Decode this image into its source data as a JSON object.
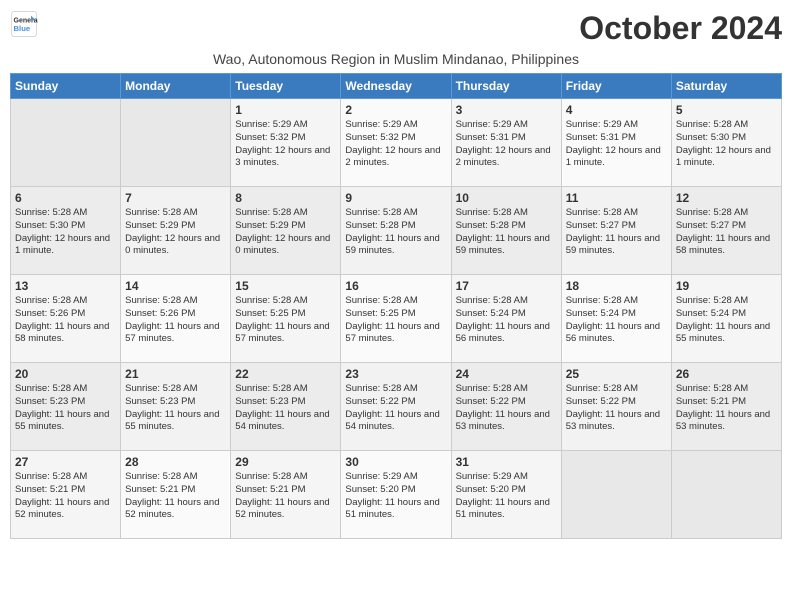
{
  "header": {
    "logo_line1": "General",
    "logo_line2": "Blue",
    "month_title": "October 2024",
    "subtitle": "Wao, Autonomous Region in Muslim Mindanao, Philippines"
  },
  "weekdays": [
    "Sunday",
    "Monday",
    "Tuesday",
    "Wednesday",
    "Thursday",
    "Friday",
    "Saturday"
  ],
  "weeks": [
    [
      {
        "day": "",
        "info": ""
      },
      {
        "day": "",
        "info": ""
      },
      {
        "day": "1",
        "info": "Sunrise: 5:29 AM\nSunset: 5:32 PM\nDaylight: 12 hours and 3 minutes."
      },
      {
        "day": "2",
        "info": "Sunrise: 5:29 AM\nSunset: 5:32 PM\nDaylight: 12 hours and 2 minutes."
      },
      {
        "day": "3",
        "info": "Sunrise: 5:29 AM\nSunset: 5:31 PM\nDaylight: 12 hours and 2 minutes."
      },
      {
        "day": "4",
        "info": "Sunrise: 5:29 AM\nSunset: 5:31 PM\nDaylight: 12 hours and 1 minute."
      },
      {
        "day": "5",
        "info": "Sunrise: 5:28 AM\nSunset: 5:30 PM\nDaylight: 12 hours and 1 minute."
      }
    ],
    [
      {
        "day": "6",
        "info": "Sunrise: 5:28 AM\nSunset: 5:30 PM\nDaylight: 12 hours and 1 minute."
      },
      {
        "day": "7",
        "info": "Sunrise: 5:28 AM\nSunset: 5:29 PM\nDaylight: 12 hours and 0 minutes."
      },
      {
        "day": "8",
        "info": "Sunrise: 5:28 AM\nSunset: 5:29 PM\nDaylight: 12 hours and 0 minutes."
      },
      {
        "day": "9",
        "info": "Sunrise: 5:28 AM\nSunset: 5:28 PM\nDaylight: 11 hours and 59 minutes."
      },
      {
        "day": "10",
        "info": "Sunrise: 5:28 AM\nSunset: 5:28 PM\nDaylight: 11 hours and 59 minutes."
      },
      {
        "day": "11",
        "info": "Sunrise: 5:28 AM\nSunset: 5:27 PM\nDaylight: 11 hours and 59 minutes."
      },
      {
        "day": "12",
        "info": "Sunrise: 5:28 AM\nSunset: 5:27 PM\nDaylight: 11 hours and 58 minutes."
      }
    ],
    [
      {
        "day": "13",
        "info": "Sunrise: 5:28 AM\nSunset: 5:26 PM\nDaylight: 11 hours and 58 minutes."
      },
      {
        "day": "14",
        "info": "Sunrise: 5:28 AM\nSunset: 5:26 PM\nDaylight: 11 hours and 57 minutes."
      },
      {
        "day": "15",
        "info": "Sunrise: 5:28 AM\nSunset: 5:25 PM\nDaylight: 11 hours and 57 minutes."
      },
      {
        "day": "16",
        "info": "Sunrise: 5:28 AM\nSunset: 5:25 PM\nDaylight: 11 hours and 57 minutes."
      },
      {
        "day": "17",
        "info": "Sunrise: 5:28 AM\nSunset: 5:24 PM\nDaylight: 11 hours and 56 minutes."
      },
      {
        "day": "18",
        "info": "Sunrise: 5:28 AM\nSunset: 5:24 PM\nDaylight: 11 hours and 56 minutes."
      },
      {
        "day": "19",
        "info": "Sunrise: 5:28 AM\nSunset: 5:24 PM\nDaylight: 11 hours and 55 minutes."
      }
    ],
    [
      {
        "day": "20",
        "info": "Sunrise: 5:28 AM\nSunset: 5:23 PM\nDaylight: 11 hours and 55 minutes."
      },
      {
        "day": "21",
        "info": "Sunrise: 5:28 AM\nSunset: 5:23 PM\nDaylight: 11 hours and 55 minutes."
      },
      {
        "day": "22",
        "info": "Sunrise: 5:28 AM\nSunset: 5:23 PM\nDaylight: 11 hours and 54 minutes."
      },
      {
        "day": "23",
        "info": "Sunrise: 5:28 AM\nSunset: 5:22 PM\nDaylight: 11 hours and 54 minutes."
      },
      {
        "day": "24",
        "info": "Sunrise: 5:28 AM\nSunset: 5:22 PM\nDaylight: 11 hours and 53 minutes."
      },
      {
        "day": "25",
        "info": "Sunrise: 5:28 AM\nSunset: 5:22 PM\nDaylight: 11 hours and 53 minutes."
      },
      {
        "day": "26",
        "info": "Sunrise: 5:28 AM\nSunset: 5:21 PM\nDaylight: 11 hours and 53 minutes."
      }
    ],
    [
      {
        "day": "27",
        "info": "Sunrise: 5:28 AM\nSunset: 5:21 PM\nDaylight: 11 hours and 52 minutes."
      },
      {
        "day": "28",
        "info": "Sunrise: 5:28 AM\nSunset: 5:21 PM\nDaylight: 11 hours and 52 minutes."
      },
      {
        "day": "29",
        "info": "Sunrise: 5:28 AM\nSunset: 5:21 PM\nDaylight: 11 hours and 52 minutes."
      },
      {
        "day": "30",
        "info": "Sunrise: 5:29 AM\nSunset: 5:20 PM\nDaylight: 11 hours and 51 minutes."
      },
      {
        "day": "31",
        "info": "Sunrise: 5:29 AM\nSunset: 5:20 PM\nDaylight: 11 hours and 51 minutes."
      },
      {
        "day": "",
        "info": ""
      },
      {
        "day": "",
        "info": ""
      }
    ]
  ]
}
